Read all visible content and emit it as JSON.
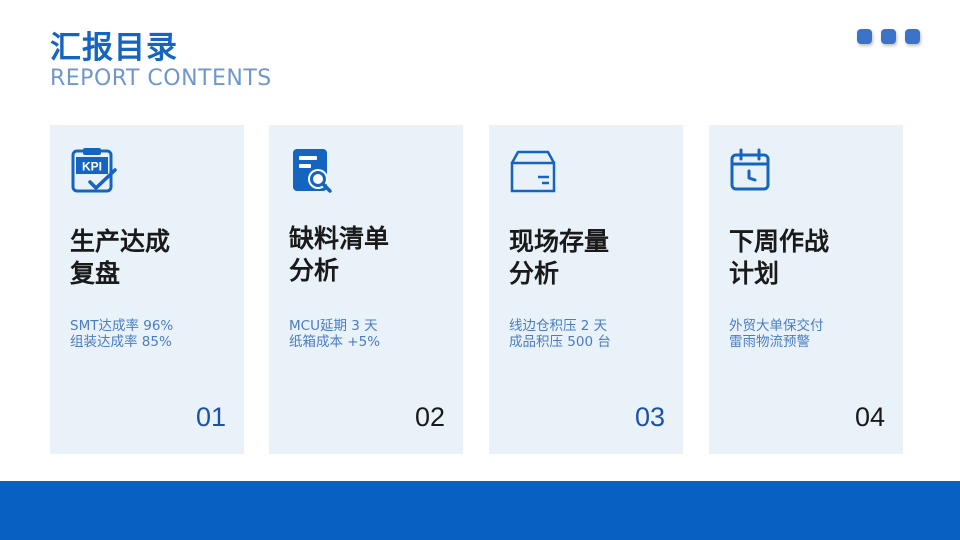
{
  "header": {
    "title": "汇报目录",
    "subtitle": "REPORT CONTENTS"
  },
  "colors": {
    "accent": "#1565c0",
    "card_bg": "#eaf2f9",
    "bottom_bar": "#0760c2",
    "num_blue": "#1a52a8",
    "num_dark": "#1a1a1a"
  },
  "cards": [
    {
      "icon": "kpi-clipboard-icon",
      "title_line1": "生产达成",
      "title_line2": "复盘",
      "desc_line1": "SMT达成率 96%",
      "desc_line2": "组装达成率 85%",
      "number": "01"
    },
    {
      "icon": "document-search-icon",
      "title_line1": "缺料清单",
      "title_line2": "分析",
      "desc_line1": "MCU延期 3 天",
      "desc_line2": "纸箱成本 +5%",
      "number": "02"
    },
    {
      "icon": "inventory-box-icon",
      "title_line1": "现场存量",
      "title_line2": "分析",
      "desc_line1": "线边仓积压 2 天",
      "desc_line2": "成品积压 500 台",
      "number": "03"
    },
    {
      "icon": "calendar-clock-icon",
      "title_line1": "下周作战",
      "title_line2": "计划",
      "desc_line1": "外贸大单保交付",
      "desc_line2": "雷雨物流预警",
      "number": "04"
    }
  ]
}
